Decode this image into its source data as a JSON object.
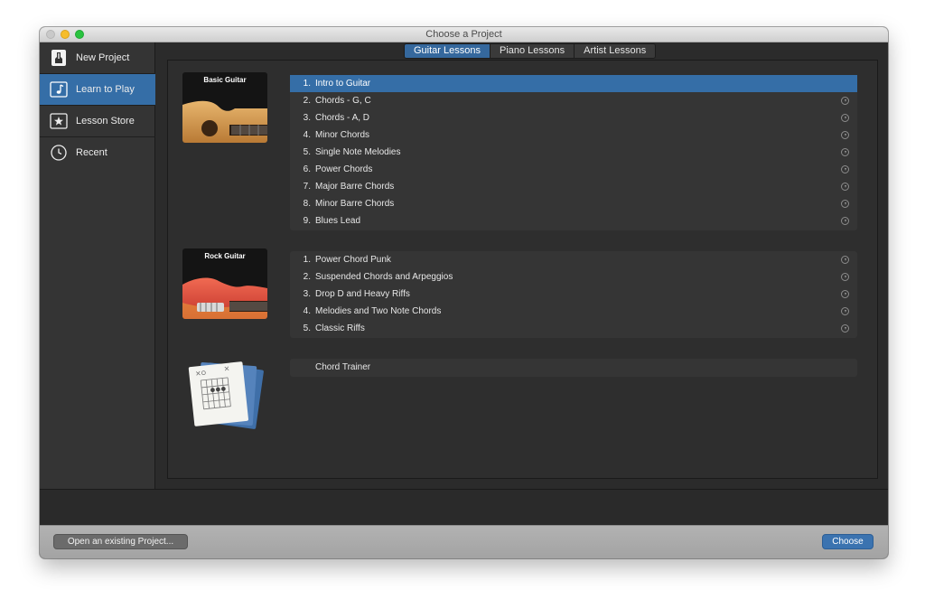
{
  "window": {
    "title": "Choose a Project"
  },
  "sidebar": {
    "items": [
      {
        "label": "New Project",
        "icon": "guitar-doc-icon"
      },
      {
        "label": "Learn to Play",
        "icon": "music-note-icon"
      },
      {
        "label": "Lesson Store",
        "icon": "star-icon"
      },
      {
        "label": "Recent",
        "icon": "clock-icon"
      }
    ],
    "selected": "Learn to Play"
  },
  "tabs": {
    "items": [
      {
        "label": "Guitar Lessons"
      },
      {
        "label": "Piano Lessons"
      },
      {
        "label": "Artist Lessons"
      }
    ],
    "selected": "Guitar Lessons"
  },
  "groups": [
    {
      "title": "Basic Guitar",
      "lessons": [
        {
          "num": "1.",
          "label": "Intro to Guitar"
        },
        {
          "num": "2.",
          "label": "Chords - G, C"
        },
        {
          "num": "3.",
          "label": "Chords - A, D"
        },
        {
          "num": "4.",
          "label": "Minor Chords"
        },
        {
          "num": "5.",
          "label": "Single Note Melodies"
        },
        {
          "num": "6.",
          "label": "Power Chords"
        },
        {
          "num": "7.",
          "label": "Major Barre Chords"
        },
        {
          "num": "8.",
          "label": "Minor Barre Chords"
        },
        {
          "num": "9.",
          "label": "Blues Lead"
        }
      ]
    },
    {
      "title": "Rock Guitar",
      "lessons": [
        {
          "num": "1.",
          "label": "Power Chord Punk"
        },
        {
          "num": "2.",
          "label": "Suspended Chords and Arpeggios"
        },
        {
          "num": "3.",
          "label": "Drop D and Heavy Riffs"
        },
        {
          "num": "4.",
          "label": "Melodies and Two Note Chords"
        },
        {
          "num": "5.",
          "label": "Classic Riffs"
        }
      ]
    },
    {
      "lessons": [
        {
          "label": "Chord Trainer"
        }
      ]
    }
  ],
  "selected_lesson": "Intro to Guitar",
  "footer": {
    "open_label": "Open an existing Project...",
    "choose_label": "Choose"
  },
  "colors": {
    "accent": "#356ea7",
    "background": "#2e2e2e"
  }
}
